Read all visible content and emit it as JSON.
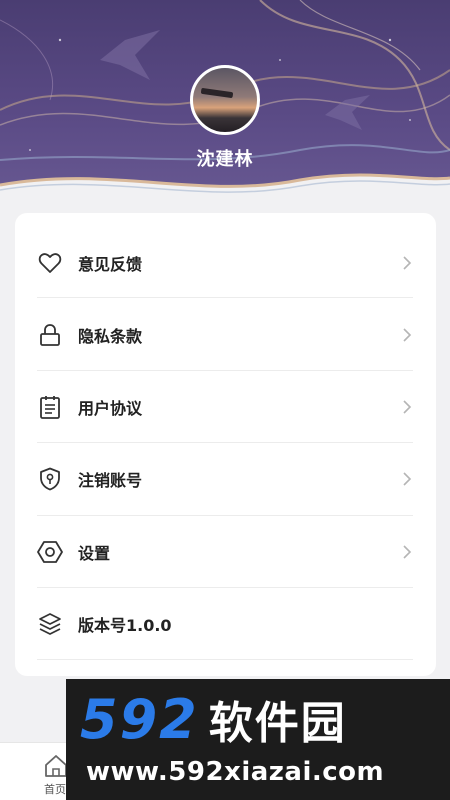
{
  "profile": {
    "name": "沈建林"
  },
  "menu": {
    "items": [
      {
        "label": "意见反馈",
        "icon": "heart-icon",
        "has_arrow": true
      },
      {
        "label": "隐私条款",
        "icon": "lock-icon",
        "has_arrow": true
      },
      {
        "label": "用户协议",
        "icon": "document-icon",
        "has_arrow": true
      },
      {
        "label": "注销账号",
        "icon": "shield-key-icon",
        "has_arrow": true
      },
      {
        "label": "设置",
        "icon": "hexagon-settings-icon",
        "has_arrow": true
      },
      {
        "label": "版本号1.0.0",
        "icon": "layers-icon",
        "has_arrow": false
      }
    ]
  },
  "tabbar": {
    "home_label": "首页"
  },
  "watermark": {
    "brand_num": "592",
    "brand_text": "软件园",
    "url": "www.592xiazai.com"
  },
  "colors": {
    "header": "#5b4b86",
    "accent_brand": "#2b7be8",
    "card": "#ffffff",
    "background": "#f1f1f3"
  }
}
